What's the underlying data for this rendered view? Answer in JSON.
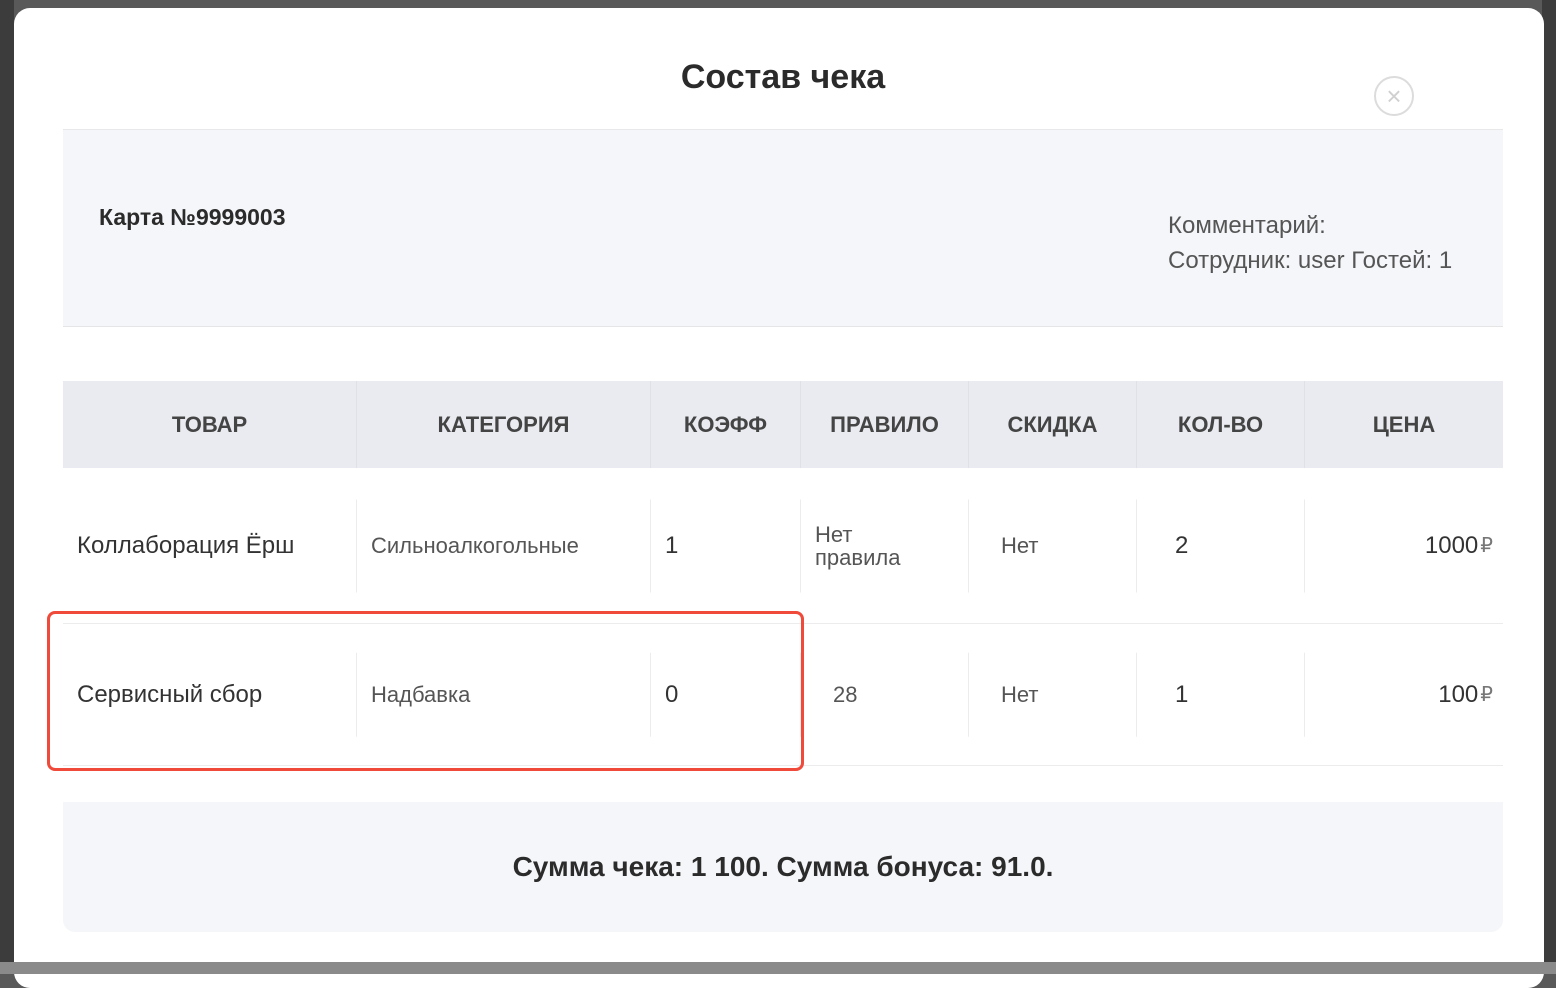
{
  "modal": {
    "title": "Состав чека",
    "close_icon": "close-circle-icon"
  },
  "info": {
    "card": "Карта №9999003",
    "comment": "Комментарий:",
    "employee": "Сотрудник: user Гостей: 1"
  },
  "table": {
    "headers": [
      "ТОВАР",
      "КАТЕГОРИЯ",
      "КОЭФФ",
      "ПРАВИЛО",
      "СКИДКА",
      "КОЛ-ВО",
      "ЦЕНА"
    ],
    "rows": [
      {
        "item": "Коллаборация Ёрш",
        "category": "Сильноалкогольные",
        "coeff": "1",
        "rule_line1": "Нет",
        "rule_line2": "правила",
        "discount": "Нет",
        "qty": "2",
        "price": "1000",
        "currency": "₽"
      },
      {
        "item": "Сервисный сбор",
        "category": "Надбавка",
        "coeff": "0",
        "rule": "28",
        "discount": "Нет",
        "qty": "1",
        "price": "100",
        "currency": "₽"
      }
    ]
  },
  "summary": {
    "text": "Сумма чека: 1 100. Сумма бонуса: 91.0."
  },
  "annotation": {
    "color": "#ef4a3a"
  }
}
